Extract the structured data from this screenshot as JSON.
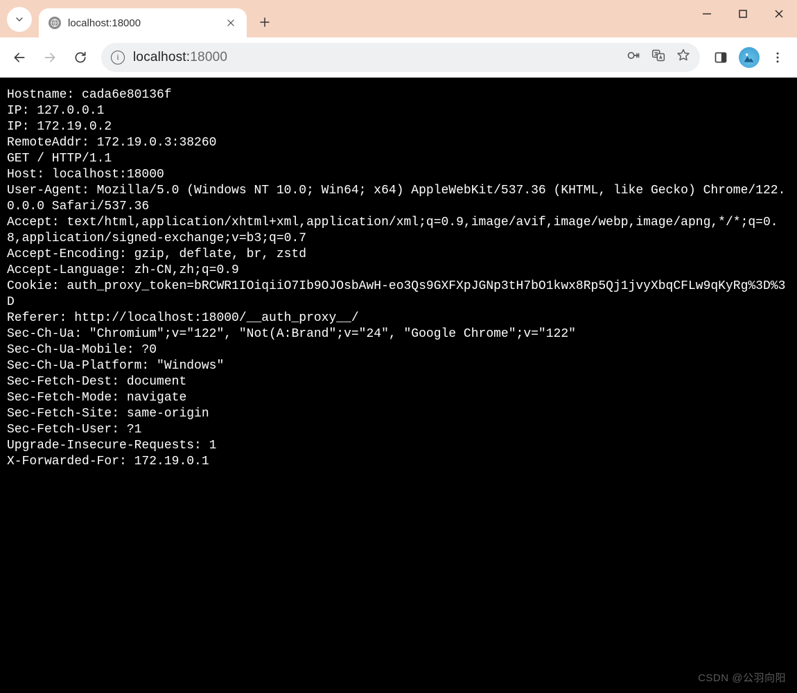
{
  "tab": {
    "title": "localhost:18000"
  },
  "omnibox": {
    "host": "localhost:",
    "port": "18000"
  },
  "watermark": "CSDN @公羽向阳",
  "page_lines": [
    "Hostname: cada6e80136f",
    "IP: 127.0.0.1",
    "IP: 172.19.0.2",
    "RemoteAddr: 172.19.0.3:38260",
    "GET / HTTP/1.1",
    "Host: localhost:18000",
    "User-Agent: Mozilla/5.0 (Windows NT 10.0; Win64; x64) AppleWebKit/537.36 (KHTML, like Gecko) Chrome/122.0.0.0 Safari/537.36",
    "Accept: text/html,application/xhtml+xml,application/xml;q=0.9,image/avif,image/webp,image/apng,*/*;q=0.8,application/signed-exchange;v=b3;q=0.7",
    "Accept-Encoding: gzip, deflate, br, zstd",
    "Accept-Language: zh-CN,zh;q=0.9",
    "Cookie: auth_proxy_token=bRCWR1IOiqiiO7Ib9OJOsbAwH-eo3Qs9GXFXpJGNp3tH7bO1kwx8Rp5Qj1jvyXbqCFLw9qKyRg%3D%3D",
    "Referer: http://localhost:18000/__auth_proxy__/",
    "Sec-Ch-Ua: \"Chromium\";v=\"122\", \"Not(A:Brand\";v=\"24\", \"Google Chrome\";v=\"122\"",
    "Sec-Ch-Ua-Mobile: ?0",
    "Sec-Ch-Ua-Platform: \"Windows\"",
    "Sec-Fetch-Dest: document",
    "Sec-Fetch-Mode: navigate",
    "Sec-Fetch-Site: same-origin",
    "Sec-Fetch-User: ?1",
    "Upgrade-Insecure-Requests: 1",
    "X-Forwarded-For: 172.19.0.1"
  ]
}
